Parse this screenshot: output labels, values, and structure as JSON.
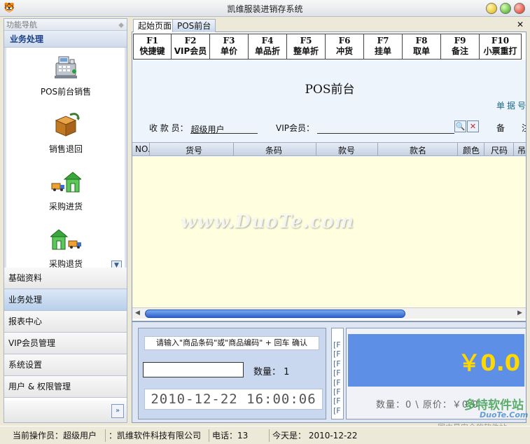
{
  "window": {
    "title": "凯维服装进销存系统"
  },
  "nav": {
    "header": "功能导航",
    "section": "业务处理",
    "items": [
      {
        "label": "POS前台销售",
        "icon": "cash-register-icon"
      },
      {
        "label": "销售退回",
        "icon": "return-box-icon"
      },
      {
        "label": "采购进货",
        "icon": "purchase-truck-house-icon"
      },
      {
        "label": "采购退货",
        "icon": "purchase-return-house-truck-icon"
      }
    ],
    "groups": [
      {
        "label": "基础资料",
        "active": false
      },
      {
        "label": "业务处理",
        "active": true
      },
      {
        "label": "报表中心",
        "active": false
      },
      {
        "label": "VIP会员管理",
        "active": false
      },
      {
        "label": "系统设置",
        "active": false
      },
      {
        "label": "用户 & 权限管理",
        "active": false
      }
    ]
  },
  "tabs": [
    {
      "label": "起始页面",
      "active": false
    },
    {
      "label": "POS前台",
      "active": true
    }
  ],
  "fkeys": [
    {
      "key": "F1",
      "label": "快捷键"
    },
    {
      "key": "F2",
      "label": "VIP会员"
    },
    {
      "key": "F3",
      "label": "单价"
    },
    {
      "key": "F4",
      "label": "单品折"
    },
    {
      "key": "F5",
      "label": "整单折"
    },
    {
      "key": "F6",
      "label": "冲货"
    },
    {
      "key": "F7",
      "label": "挂单"
    },
    {
      "key": "F8",
      "label": "取单"
    },
    {
      "key": "F9",
      "label": "备注"
    },
    {
      "key": "F10",
      "label": "小票重打"
    }
  ],
  "pos": {
    "title": "POS前台",
    "doc_no_label": "单据号",
    "cashier_label": "收 款 员：",
    "cashier_value": "超级用户",
    "vip_label": "VIP会员：",
    "vip_value": "",
    "remark_label": "备",
    "extra_label": "注"
  },
  "grid": {
    "columns": [
      "NO.",
      "货号",
      "条码",
      "款号",
      "款名",
      "颜色",
      "尺码",
      "吊"
    ]
  },
  "input_panel": {
    "hint": "请输入\"商品条码\"或\"商品编码\" + 回车 确认",
    "barcode_value": "",
    "qty_label": "数量：",
    "qty_value": "1",
    "clock": "2010-12-22 16:00:06"
  },
  "fk_list": [
    "[F",
    "[F",
    "[F",
    "[F",
    "[F",
    "[F",
    "[F",
    "[F"
  ],
  "total": {
    "amount": "￥0.0",
    "info": "数量：0 \\ 原价：￥0.0"
  },
  "watermark": "www.DuoTe.com",
  "statusbar": {
    "operator": "当前操作员：超级用户",
    "company": "：凯维软件科技有限公司",
    "phone": "电话：13",
    "today": "今天是：  2010-12-22"
  },
  "logo": {
    "big": "多特软件站",
    "small": "DuoTe.Com",
    "tag": "国内最安全的软件站"
  }
}
